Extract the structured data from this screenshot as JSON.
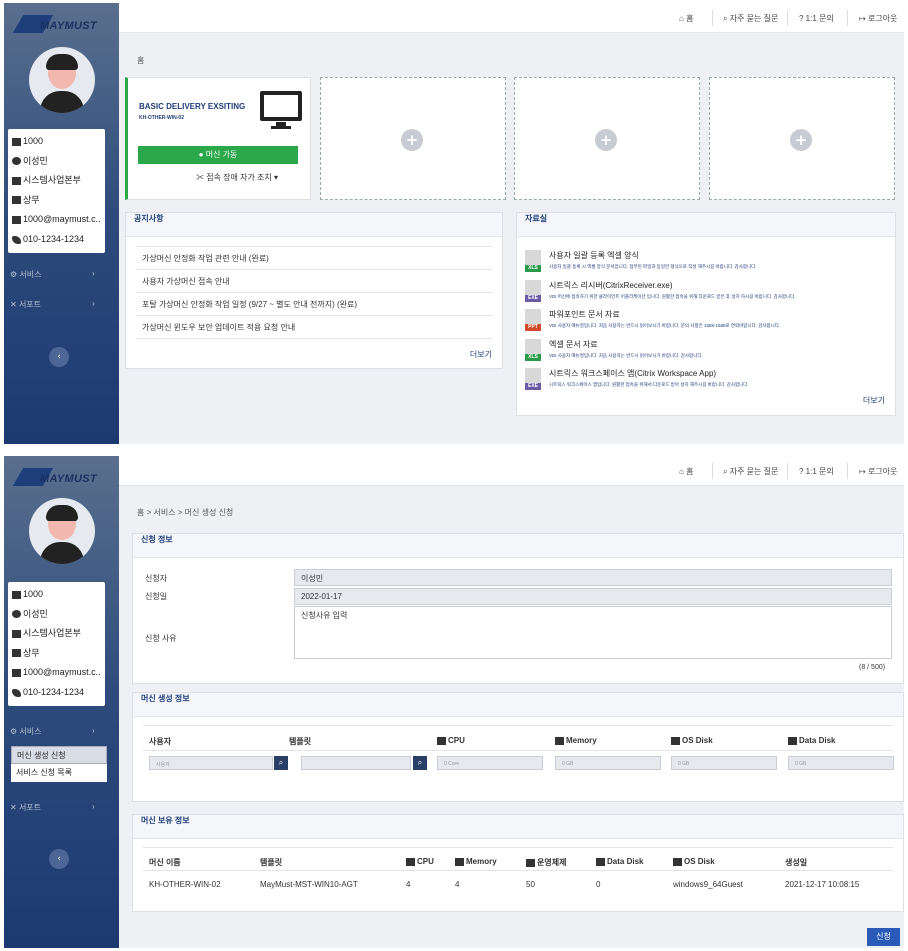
{
  "brand": "MAYMUST",
  "topbar": {
    "home": "홈",
    "faq": "자주 묻는 질문",
    "inquiry": "1:1 문의",
    "logout": "로그아웃"
  },
  "profile": {
    "id": "1000",
    "name": "이성민",
    "dept": "시스템사업본부",
    "title": "상무",
    "email": "1000@maymust.c...",
    "phone": "010-1234-1234"
  },
  "nav": {
    "service": "서비스",
    "support": "서포트",
    "sub_create": "머신 생성 신청",
    "sub_list": "서비스 신청 목록",
    "arrow": "›",
    "collapse": "‹"
  },
  "dash": {
    "crumb": "홈",
    "vm_title": "BASIC DELIVERY EXSITING",
    "vm_sub": "KH-OTHER-WIN-02",
    "run": "머신 가동",
    "fix": "접속 장애 자가 조치",
    "notice_title": "공지사항",
    "notices": [
      "가상머신 안정화 작업 관련 안내 (완료)",
      "사용자 가상머신 접속 안내",
      "포탈 가상머신 안정화 작업 일정 (9/27 ~ 별도 안내 전까지) (완료)",
      "가상머신 윈도우 보안 업데이트 적용 요청 안내"
    ],
    "more": "더보기",
    "files_title": "자료실",
    "files": [
      {
        "title": "사용자 일괄 등록 엑셀 양식",
        "desc": "사용자 일괄 등록 시 엑셀 양식 문서입니다. 첨부된 파일과 동일한 형식으로 작성 해주시길 바랍니다. 감사합니다.",
        "tag": "XLS",
        "color": "#2a9a48"
      },
      {
        "title": "시트릭스 리시버(CitrixReceiver.exe)",
        "desc": "VDI 머신에 접속하기 위한 클라이언트 어플리케이션 입니다. 원활한 접속을 위해 다운로드 받은 후 설치 하시길 바랍니다. 감사합니다.",
        "tag": "EXE",
        "color": "#6a5aa8"
      },
      {
        "title": "파워포인트 문서 자료",
        "desc": "VDI 사용자 매뉴얼입니다. 처음 사용자는 반드시 읽어보시기 바랍니다. 문의 사항은 1588-1588로 연락바랍니다. 감사합니다.",
        "tag": "PPT",
        "color": "#d24a2a"
      },
      {
        "title": "엑셀 문서 자료",
        "desc": "VDI 사용자 매뉴얼입니다. 처음 사용자는 반드시 읽어보시기 바랍니다. 감사합니다.",
        "tag": "XLS",
        "color": "#2a9a48"
      },
      {
        "title": "시트릭스 워크스페이스 앱(Citrix Workspace App)",
        "desc": "시트릭스 워크스페이스 앱입니다. 원활한 접속을 위해서 다운로드 받아 설치 해주시길 바랍니다. 감사합니다.",
        "tag": "EXE",
        "color": "#6a5aa8"
      }
    ]
  },
  "req": {
    "crumb": "홈 > 서비스 > 머신 생성 신청",
    "info_title": "신청 정보",
    "applicant_label": "신청자",
    "applicant": "이성민",
    "date_label": "신청일",
    "date": "2022-01-17",
    "reason_label": "신청 사유",
    "reason": "신청사유 입력",
    "counter": "(8 / 500)",
    "create_title": "머신 생성 정보",
    "create_cols": [
      "사용자",
      "템플릿",
      "CPU",
      "Memory",
      "OS Disk",
      "Data Disk"
    ],
    "user_ph": "사용자",
    "cpu_ph": "0 Core",
    "mem_ph": "0 GB",
    "os_ph": "0 GB",
    "data_ph": "0 GB",
    "owned_title": "머신 보유 정보",
    "owned_cols": [
      "머신 이름",
      "템플릿",
      "CPU",
      "Memory",
      "운영체제",
      "Data Disk",
      "OS Disk",
      "생성일"
    ],
    "owned_row": [
      "KH-OTHER-WIN-02",
      "MayMust-MST-WIN10-AGT",
      "4",
      "4",
      "50",
      "0",
      "windows9_64Guest",
      "2021-12-17 10:08:15"
    ],
    "submit": "신청"
  }
}
